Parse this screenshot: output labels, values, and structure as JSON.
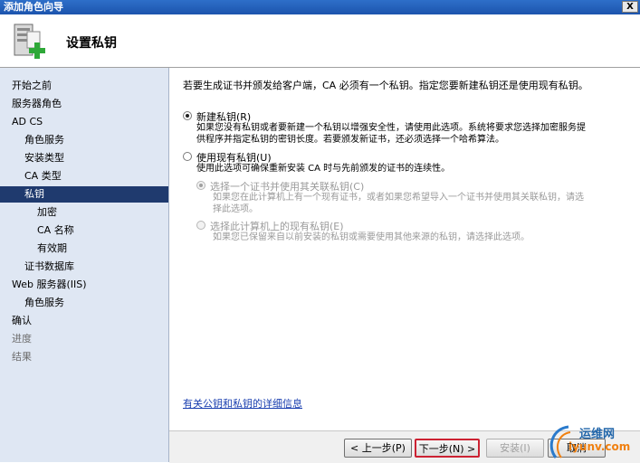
{
  "window": {
    "title": "添加角色向导",
    "close_label": "X"
  },
  "header": {
    "title": "设置私钥"
  },
  "sidebar": {
    "items": [
      {
        "label": "开始之前"
      },
      {
        "label": "服务器角色"
      },
      {
        "label": "AD CS"
      },
      {
        "label": "角色服务"
      },
      {
        "label": "安装类型"
      },
      {
        "label": "CA 类型"
      },
      {
        "label": "私钥"
      },
      {
        "label": "加密"
      },
      {
        "label": "CA 名称"
      },
      {
        "label": "有效期"
      },
      {
        "label": "证书数据库"
      },
      {
        "label": "Web 服务器(IIS)"
      },
      {
        "label": "角色服务"
      },
      {
        "label": "确认"
      },
      {
        "label": "进度"
      },
      {
        "label": "结果"
      }
    ]
  },
  "main": {
    "intro": "若要生成证书并颁发给客户端，CA 必须有一个私钥。指定您要新建私钥还是使用现有私钥。",
    "option_new": {
      "label": "新建私钥(R)",
      "desc_line1": "如果您没有私钥或者要新建一个私钥以增强安全性，请使用此选项。系统将要求您选择加密服务提",
      "desc_line2": "供程序并指定私钥的密钥长度。若要颁发新证书，还必须选择一个哈希算法。"
    },
    "option_existing": {
      "label": "使用现有私钥(U)",
      "desc": "使用此选项可确保重新安装 CA 时与先前颁发的证书的连续性。"
    },
    "sub_option_cert": {
      "label": "选择一个证书并使用其关联私钥(C)",
      "desc_line1": "如果您在此计算机上有一个现有证书，或者如果您希望导入一个证书并使用其关联私钥，请选",
      "desc_line2": "择此选项。"
    },
    "sub_option_key": {
      "label": "选择此计算机上的现有私钥(E)",
      "desc": "如果您已保留来自以前安装的私钥或需要使用其他来源的私钥，请选择此选项。"
    },
    "link": "有关公钥和私钥的详细信息"
  },
  "buttons": {
    "back": "< 上一步(P)",
    "next": "下一步(N) >",
    "install": "安装(I)",
    "cancel": "取消"
  },
  "watermark": {
    "text": "运维网",
    "sub": "iyunv.com"
  },
  "colors": {
    "selected_nav": "#1f3a6e",
    "sidebar_bg": "#dfe7f3",
    "titlebar": "#1c54ad",
    "primary_border": "#cc2233"
  }
}
